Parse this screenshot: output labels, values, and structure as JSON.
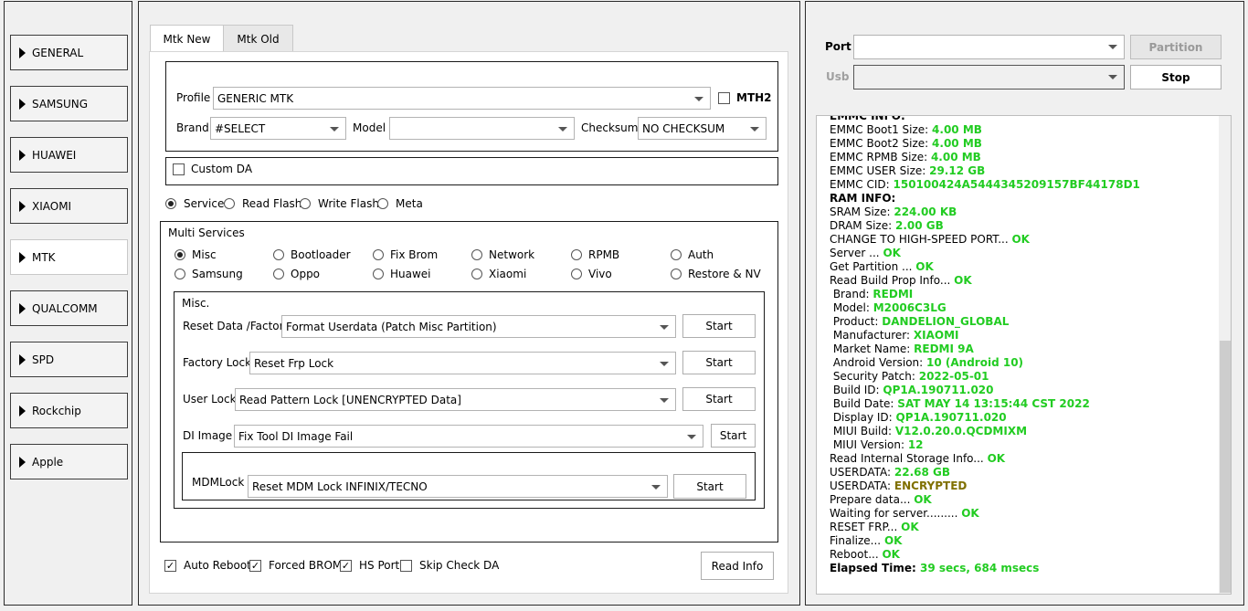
{
  "sidebar": {
    "items": [
      {
        "label": "GENERAL"
      },
      {
        "label": "SAMSUNG"
      },
      {
        "label": "HUAWEI"
      },
      {
        "label": "XIAOMI"
      },
      {
        "label": "MTK"
      },
      {
        "label": "QUALCOMM"
      },
      {
        "label": "SPD"
      },
      {
        "label": "Rockchip"
      },
      {
        "label": "Apple"
      }
    ],
    "active": "MTK"
  },
  "tabs": [
    {
      "label": "Mtk New"
    },
    {
      "label": "Mtk Old"
    }
  ],
  "profile": {
    "label": "Profile",
    "value": "GENERIC MTK",
    "mth2_label": "MTH2"
  },
  "brand": {
    "label": "Brand",
    "value": "#SELECT"
  },
  "model": {
    "label": "Model",
    "value": ""
  },
  "checksum": {
    "label": "Checksum",
    "value": "NO CHECKSUM"
  },
  "custom_da": {
    "label": "Custom DA"
  },
  "modes": [
    {
      "label": "Service",
      "selected": true
    },
    {
      "label": "Read Flash",
      "selected": false
    },
    {
      "label": "Write Flash",
      "selected": false
    },
    {
      "label": "Meta",
      "selected": false
    }
  ],
  "multi_services": {
    "title": "Multi Services",
    "options": [
      {
        "label": "Misc",
        "selected": true
      },
      {
        "label": "Bootloader",
        "selected": false
      },
      {
        "label": "Fix Brom",
        "selected": false
      },
      {
        "label": "Network",
        "selected": false
      },
      {
        "label": "RPMB",
        "selected": false
      },
      {
        "label": "Auth",
        "selected": false
      },
      {
        "label": "Samsung",
        "selected": false
      },
      {
        "label": "Oppo",
        "selected": false
      },
      {
        "label": "Huawei",
        "selected": false
      },
      {
        "label": "Xiaomi",
        "selected": false
      },
      {
        "label": "Vivo",
        "selected": false
      },
      {
        "label": "Restore & NV",
        "selected": false
      }
    ]
  },
  "misc": {
    "title": "Misc.",
    "rows": [
      {
        "label": "Reset Data /Factory",
        "value": "Format Userdata (Patch Misc Partition)",
        "button": "Start"
      },
      {
        "label": "Factory Lock",
        "value": "Reset Frp Lock",
        "button": "Start"
      },
      {
        "label": "User Lock",
        "value": "Read Pattern Lock [UNENCRYPTED Data]",
        "button": "Start"
      },
      {
        "label": "DI Image",
        "value": "Fix Tool DI Image Fail",
        "button": "Start"
      }
    ],
    "mdm": {
      "label": "MDMLock",
      "value": "Reset MDM Lock INFINIX/TECNO",
      "button": "Start"
    }
  },
  "options": [
    {
      "label": "Auto Reboot",
      "checked": true
    },
    {
      "label": "Forced BROM",
      "checked": true
    },
    {
      "label": "HS Port",
      "checked": true
    },
    {
      "label": "Skip Check DA",
      "checked": false
    }
  ],
  "read_info_button": "Read Info",
  "port": {
    "label": "Port",
    "value": "",
    "partition_button": "Partition"
  },
  "usb": {
    "label": "Usb",
    "value": "",
    "stop_button": "Stop"
  },
  "log": {
    "lines": [
      [
        {
          "t": "EMMC INFO:",
          "c": "bold"
        }
      ],
      [
        {
          "t": "EMMC Boot1 Size: "
        },
        {
          "t": "4.00 MB",
          "c": "val"
        }
      ],
      [
        {
          "t": "EMMC Boot2 Size: "
        },
        {
          "t": "4.00 MB",
          "c": "val"
        }
      ],
      [
        {
          "t": "EMMC RPMB Size: "
        },
        {
          "t": "4.00 MB",
          "c": "val"
        }
      ],
      [
        {
          "t": "EMMC USER Size: "
        },
        {
          "t": "29.12 GB",
          "c": "val"
        }
      ],
      [
        {
          "t": "EMMC CID: "
        },
        {
          "t": "150100424A5444345209157BF44178D1",
          "c": "val"
        }
      ],
      [
        {
          "t": "RAM INFO:",
          "c": "bold"
        }
      ],
      [
        {
          "t": "SRAM Size: "
        },
        {
          "t": "224.00 KB",
          "c": "val"
        }
      ],
      [
        {
          "t": "DRAM Size: "
        },
        {
          "t": "2.00 GB",
          "c": "val"
        }
      ],
      [
        {
          "t": "CHANGE TO HIGH-SPEED PORT... "
        },
        {
          "t": "OK",
          "c": "ok"
        }
      ],
      [
        {
          "t": "Server ... "
        },
        {
          "t": "OK",
          "c": "ok"
        }
      ],
      [
        {
          "t": "Get Partition ... "
        },
        {
          "t": "OK",
          "c": "ok"
        }
      ],
      [
        {
          "t": "Read Build Prop Info... "
        },
        {
          "t": "OK",
          "c": "ok"
        }
      ],
      [
        {
          "t": " Brand: "
        },
        {
          "t": "REDMI",
          "c": "val"
        }
      ],
      [
        {
          "t": " Model: "
        },
        {
          "t": "M2006C3LG",
          "c": "val"
        }
      ],
      [
        {
          "t": " Product: "
        },
        {
          "t": "DANDELION_GLOBAL",
          "c": "val"
        }
      ],
      [
        {
          "t": " Manufacturer: "
        },
        {
          "t": "XIAOMI",
          "c": "val"
        }
      ],
      [
        {
          "t": " Market Name: "
        },
        {
          "t": "REDMI 9A",
          "c": "val"
        }
      ],
      [
        {
          "t": " Android Version: "
        },
        {
          "t": "10 (Android 10)",
          "c": "val"
        }
      ],
      [
        {
          "t": " Security Patch: "
        },
        {
          "t": "2022-05-01",
          "c": "val"
        }
      ],
      [
        {
          "t": " Build ID: "
        },
        {
          "t": "QP1A.190711.020",
          "c": "val"
        }
      ],
      [
        {
          "t": " Build Date: "
        },
        {
          "t": "SAT MAY 14 13:15:44 CST 2022",
          "c": "val"
        }
      ],
      [
        {
          "t": " Display ID: "
        },
        {
          "t": "QP1A.190711.020",
          "c": "val"
        }
      ],
      [
        {
          "t": " MIUI Build: "
        },
        {
          "t": "V12.0.20.0.QCDMIXM",
          "c": "val"
        }
      ],
      [
        {
          "t": " MIUI Version: "
        },
        {
          "t": "12",
          "c": "val"
        }
      ],
      [
        {
          "t": "Read Internal Storage Info... "
        },
        {
          "t": "OK",
          "c": "ok"
        }
      ],
      [
        {
          "t": "USERDATA: "
        },
        {
          "t": "22.68 GB",
          "c": "val"
        }
      ],
      [
        {
          "t": "USERDATA: "
        },
        {
          "t": "ENCRYPTED",
          "c": "warn"
        }
      ],
      [
        {
          "t": "Prepare data... "
        },
        {
          "t": "OK",
          "c": "ok"
        }
      ],
      [
        {
          "t": "Waiting for server......... "
        },
        {
          "t": "OK",
          "c": "ok"
        }
      ],
      [
        {
          "t": "RESET FRP... "
        },
        {
          "t": "OK",
          "c": "ok"
        }
      ],
      [
        {
          "t": "Finalize... "
        },
        {
          "t": "OK",
          "c": "ok"
        }
      ],
      [
        {
          "t": "Reboot... "
        },
        {
          "t": "OK",
          "c": "ok"
        }
      ],
      [
        {
          "t": "Elapsed Time: ",
          "c": "bold"
        },
        {
          "t": "39 secs, 684 msecs",
          "c": "val"
        }
      ]
    ]
  }
}
